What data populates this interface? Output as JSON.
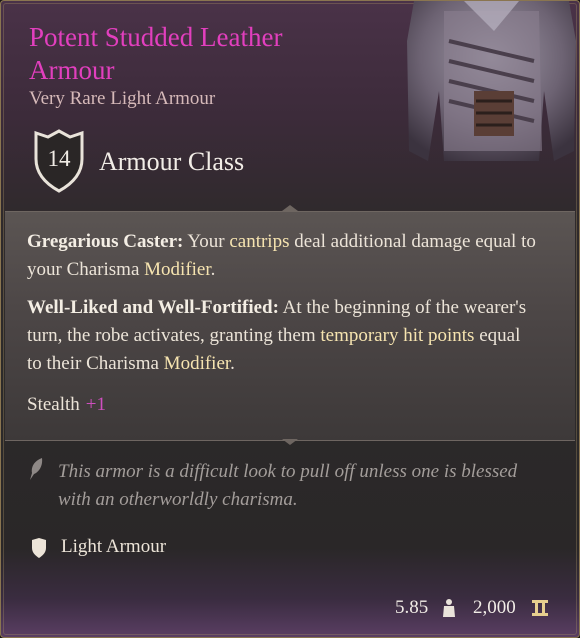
{
  "item": {
    "name_line1": "Potent Studded Leather",
    "name_line2": "Armour",
    "rarity_type": "Very Rare Light Armour",
    "armour_class_value": "14",
    "armour_class_label": "Armour Class",
    "image_icon": "leather-armour-icon",
    "rarity_color": "#e23fbe"
  },
  "effects": [
    {
      "name": "Gregarious Caster:",
      "text": [
        {
          "t": " Your ",
          "hl": false
        },
        {
          "t": "cantrips",
          "hl": true
        },
        {
          "t": " deal additional damage equal to your Charisma ",
          "hl": false
        },
        {
          "t": "Modifier",
          "hl": true
        },
        {
          "t": ".",
          "hl": false
        }
      ]
    },
    {
      "name": "Well-Liked and Well-Fortified:",
      "text": [
        {
          "t": " At the beginning of the wearer's turn, the robe activates, granting them ",
          "hl": false
        },
        {
          "t": "temporary hit points",
          "hl": true
        },
        {
          "t": " equal to their Charisma ",
          "hl": false
        },
        {
          "t": "Modifier",
          "hl": true
        },
        {
          "t": ".",
          "hl": false
        }
      ]
    }
  ],
  "stealth": {
    "label": "Stealth",
    "bonus": "+1"
  },
  "flavor": {
    "icon": "quill-icon",
    "text": "This armor is a difficult look to pull off unless one is blessed with an otherworldly charisma."
  },
  "armour_type": {
    "icon": "shield-icon",
    "label": "Light Armour"
  },
  "footer": {
    "weight": "5.85",
    "weight_icon": "weight-icon",
    "value": "2,000",
    "value_icon": "gold-coin-icon"
  }
}
